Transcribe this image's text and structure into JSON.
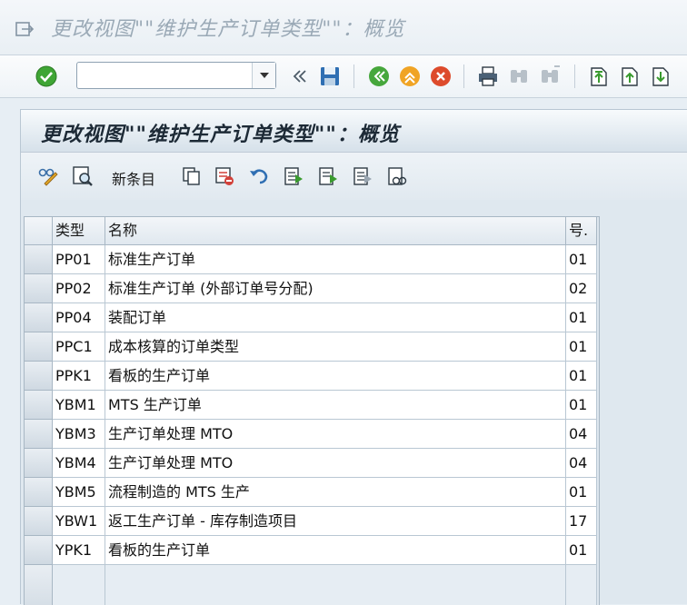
{
  "window": {
    "title": "更改视图\"\"维护生产订单类型\"\"：概览"
  },
  "toolbar": {
    "command_value": "",
    "icons": [
      "enter-icon",
      "save-icon",
      "back-icon",
      "exit-icon",
      "cancel-icon",
      "print-icon",
      "find-icon",
      "find-next-icon",
      "first-page-icon",
      "previous-page-icon",
      "next-page-icon"
    ]
  },
  "panel": {
    "title": "更改视图\"\"维护生产订单类型\"\"：概览",
    "new_entries_label": "新条目"
  },
  "table": {
    "headers": {
      "type": "类型",
      "name": "名称",
      "num": "号."
    },
    "rows": [
      {
        "type": "PP01",
        "name": "标准生产订单",
        "num": "01"
      },
      {
        "type": "PP02",
        "name": "标准生产订单 (外部订单号分配)",
        "num": "02"
      },
      {
        "type": "PP04",
        "name": "装配订单",
        "num": "01"
      },
      {
        "type": "PPC1",
        "name": "成本核算的订单类型",
        "num": "01"
      },
      {
        "type": "PPK1",
        "name": "看板的生产订单",
        "num": "01"
      },
      {
        "type": "YBM1",
        "name": "MTS 生产订单",
        "num": "01"
      },
      {
        "type": "YBM3",
        "name": "生产订单处理 MTO",
        "num": "04"
      },
      {
        "type": "YBM4",
        "name": "生产订单处理 MTO",
        "num": "04"
      },
      {
        "type": "YBM5",
        "name": "流程制造的 MTS 生产",
        "num": "01"
      },
      {
        "type": "YBW1",
        "name": "返工生产订单 - 库存制造项目",
        "num": "17"
      },
      {
        "type": "YPK1",
        "name": "看板的生产订单",
        "num": "01"
      }
    ]
  }
}
